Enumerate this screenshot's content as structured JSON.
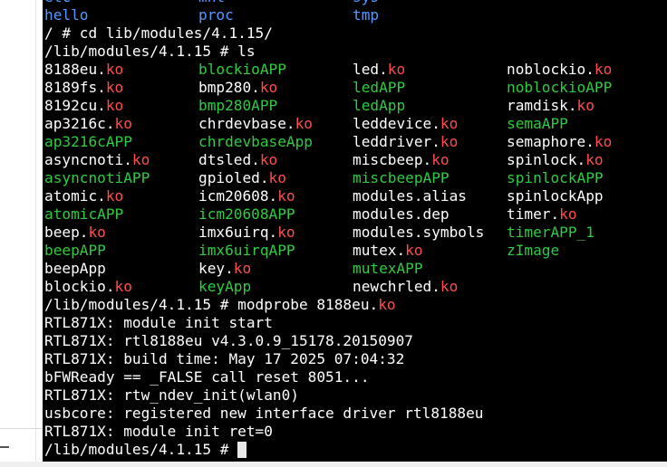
{
  "terminal": {
    "dir_row_top": [
      "etc",
      "mnt",
      "sys"
    ],
    "dir_row": [
      "hello",
      "proc",
      "tmp"
    ],
    "cd_command": "/ # cd lib/modules/4.1.15/",
    "ls_command": "/lib/modules/4.1.15 # ls",
    "files": [
      [
        {
          "base": "8188eu.",
          "ext": "ko",
          "type": "ko"
        },
        {
          "base": "blockioAPP",
          "ext": "",
          "type": "app"
        },
        {
          "base": "led.",
          "ext": "ko",
          "type": "ko"
        },
        {
          "base": "noblockio.",
          "ext": "ko",
          "type": "ko"
        }
      ],
      [
        {
          "base": "8189fs.",
          "ext": "ko",
          "type": "ko"
        },
        {
          "base": "bmp280.",
          "ext": "ko",
          "type": "ko"
        },
        {
          "base": "ledAPP",
          "ext": "",
          "type": "app"
        },
        {
          "base": "noblockioAPP",
          "ext": "",
          "type": "app"
        }
      ],
      [
        {
          "base": "8192cu.",
          "ext": "ko",
          "type": "ko"
        },
        {
          "base": "bmp280APP",
          "ext": "",
          "type": "app"
        },
        {
          "base": "ledApp",
          "ext": "",
          "type": "app"
        },
        {
          "base": "ramdisk.",
          "ext": "ko",
          "type": "ko"
        }
      ],
      [
        {
          "base": "ap3216c.",
          "ext": "ko",
          "type": "ko"
        },
        {
          "base": "chrdevbase.",
          "ext": "ko",
          "type": "ko"
        },
        {
          "base": "leddevice.",
          "ext": "ko",
          "type": "ko"
        },
        {
          "base": "semaAPP",
          "ext": "",
          "type": "app"
        }
      ],
      [
        {
          "base": "ap3216cAPP",
          "ext": "",
          "type": "app"
        },
        {
          "base": "chrdevbaseApp",
          "ext": "",
          "type": "app"
        },
        {
          "base": "leddriver.",
          "ext": "ko",
          "type": "ko"
        },
        {
          "base": "semaphore.",
          "ext": "ko",
          "type": "ko"
        }
      ],
      [
        {
          "base": "asyncnoti.",
          "ext": "ko",
          "type": "ko"
        },
        {
          "base": "dtsled.",
          "ext": "ko",
          "type": "ko"
        },
        {
          "base": "miscbeep.",
          "ext": "ko",
          "type": "ko"
        },
        {
          "base": "spinlock.",
          "ext": "ko",
          "type": "ko"
        }
      ],
      [
        {
          "base": "asyncnotiAPP",
          "ext": "",
          "type": "app"
        },
        {
          "base": "gpioled.",
          "ext": "ko",
          "type": "ko"
        },
        {
          "base": "miscbeepAPP",
          "ext": "",
          "type": "app"
        },
        {
          "base": "spinlockAPP",
          "ext": "",
          "type": "app"
        }
      ],
      [
        {
          "base": "atomic.",
          "ext": "ko",
          "type": "ko"
        },
        {
          "base": "icm20608.",
          "ext": "ko",
          "type": "ko"
        },
        {
          "base": "modules.alias",
          "ext": "",
          "type": "plain"
        },
        {
          "base": "spinlockApp",
          "ext": "",
          "type": "plain"
        }
      ],
      [
        {
          "base": "atomicAPP",
          "ext": "",
          "type": "app"
        },
        {
          "base": "icm20608APP",
          "ext": "",
          "type": "app"
        },
        {
          "base": "modules.dep",
          "ext": "",
          "type": "plain"
        },
        {
          "base": "timer.",
          "ext": "ko",
          "type": "ko"
        }
      ],
      [
        {
          "base": "beep.",
          "ext": "ko",
          "type": "ko"
        },
        {
          "base": "imx6uirq.",
          "ext": "ko",
          "type": "ko"
        },
        {
          "base": "modules.symbols",
          "ext": "",
          "type": "plain"
        },
        {
          "base": "timerAPP_1",
          "ext": "",
          "type": "app"
        }
      ],
      [
        {
          "base": "beepAPP",
          "ext": "",
          "type": "app"
        },
        {
          "base": "imx6uirqAPP",
          "ext": "",
          "type": "app"
        },
        {
          "base": "mutex.",
          "ext": "ko",
          "type": "ko"
        },
        {
          "base": "zImage",
          "ext": "",
          "type": "app"
        }
      ],
      [
        {
          "base": "beepApp",
          "ext": "",
          "type": "plain"
        },
        {
          "base": "key.",
          "ext": "ko",
          "type": "ko"
        },
        {
          "base": "mutexAPP",
          "ext": "",
          "type": "app"
        },
        {
          "base": "",
          "ext": "",
          "type": "plain"
        }
      ],
      [
        {
          "base": "blockio.",
          "ext": "ko",
          "type": "ko"
        },
        {
          "base": "keyApp",
          "ext": "",
          "type": "app"
        },
        {
          "base": "newchrled.",
          "ext": "ko",
          "type": "ko"
        },
        {
          "base": "",
          "ext": "",
          "type": "plain"
        }
      ]
    ],
    "modprobe_prompt": "/lib/modules/4.1.15 # modprobe 8188eu.",
    "modprobe_ext": "ko",
    "log_lines": [
      "RTL871X: module init start",
      "RTL871X: rtl8188eu v4.3.0.9_15178.20150907",
      "RTL871X: build time: May 17 2025 07:04:32",
      "bFWReady == _FALSE call reset 8051...",
      "RTL871X: rtw_ndev_init(wlan0)",
      "usbcore: registered new interface driver rtl8188eu",
      "RTL871X: module init ret=0"
    ],
    "final_prompt": "/lib/modules/4.1.15 # ",
    "colors": {
      "background": "#000000",
      "text": "#ffffff",
      "ko_ext": "#ff4d4d",
      "executable": "#2ecc40",
      "directory": "#5599ff"
    }
  }
}
